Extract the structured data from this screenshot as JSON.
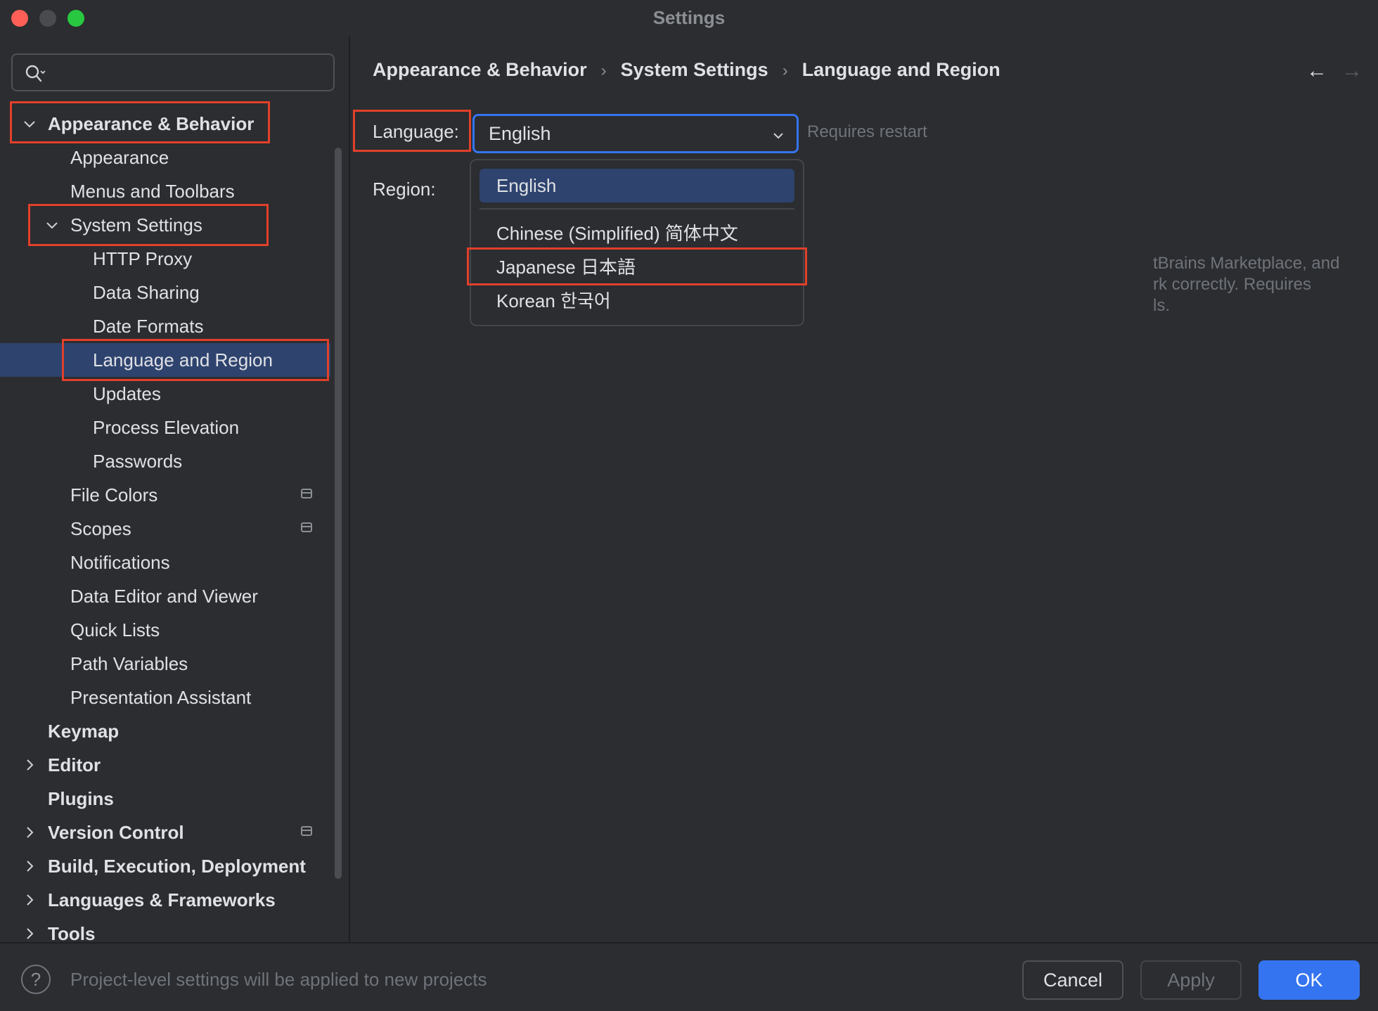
{
  "window": {
    "title": "Settings"
  },
  "search": {
    "placeholder": ""
  },
  "sidebar": {
    "items": [
      {
        "label": "Appearance & Behavior",
        "level": 0,
        "bold": true,
        "expanded": true
      },
      {
        "label": "Appearance",
        "level": 1
      },
      {
        "label": "Menus and Toolbars",
        "level": 1
      },
      {
        "label": "System Settings",
        "level": 1,
        "expanded": true
      },
      {
        "label": "HTTP Proxy",
        "level": 2
      },
      {
        "label": "Data Sharing",
        "level": 2
      },
      {
        "label": "Date Formats",
        "level": 2
      },
      {
        "label": "Language and Region",
        "level": 2,
        "selected": true
      },
      {
        "label": "Updates",
        "level": 2
      },
      {
        "label": "Process Elevation",
        "level": 2
      },
      {
        "label": "Passwords",
        "level": 2
      },
      {
        "label": "File Colors",
        "level": 1,
        "badge": true
      },
      {
        "label": "Scopes",
        "level": 1,
        "badge": true
      },
      {
        "label": "Notifications",
        "level": 1
      },
      {
        "label": "Data Editor and Viewer",
        "level": 1
      },
      {
        "label": "Quick Lists",
        "level": 1
      },
      {
        "label": "Path Variables",
        "level": 1
      },
      {
        "label": "Presentation Assistant",
        "level": 1
      },
      {
        "label": "Keymap",
        "level": 0,
        "bold": true
      },
      {
        "label": "Editor",
        "level": 0,
        "bold": true,
        "collapsed": true
      },
      {
        "label": "Plugins",
        "level": 0,
        "bold": true
      },
      {
        "label": "Version Control",
        "level": 0,
        "bold": true,
        "collapsed": true,
        "badge": true
      },
      {
        "label": "Build, Execution, Deployment",
        "level": 0,
        "bold": true,
        "collapsed": true
      },
      {
        "label": "Languages & Frameworks",
        "level": 0,
        "bold": true,
        "collapsed": true
      },
      {
        "label": "Tools",
        "level": 0,
        "bold": true,
        "collapsed": true
      }
    ]
  },
  "breadcrumb": {
    "items": [
      "Appearance & Behavior",
      "System Settings",
      "Language and Region"
    ],
    "separator": "›",
    "back": "←",
    "forward": "→"
  },
  "form": {
    "language_label": "Language:",
    "language_value": "English",
    "requires_restart": "Requires restart",
    "region_label": "Region:",
    "obscured_text": [
      "tBrains Marketplace, and",
      "rk correctly. Requires",
      "ls."
    ]
  },
  "dropdown": {
    "selected": "English",
    "options": [
      "English",
      "Chinese (Simplified) 简体中文",
      "Japanese 日本語",
      "Korean 한국어"
    ]
  },
  "footer": {
    "help": "?",
    "note": "Project-level settings will be applied to new projects",
    "cancel": "Cancel",
    "apply": "Apply",
    "ok": "OK"
  },
  "colors": {
    "accent": "#3574f0",
    "selection": "#2e436e",
    "annotation": "#e2402b"
  }
}
